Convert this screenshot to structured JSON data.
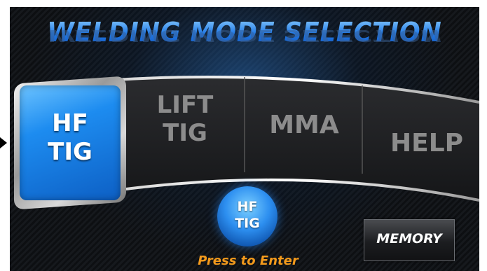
{
  "title": "WELDING MODE SELECTION",
  "tabs": [
    {
      "id": "hf-tig",
      "line1": "HF",
      "line2": "TIG",
      "selected": true
    },
    {
      "id": "lift-tig",
      "line1": "LIFT",
      "line2": "TIG",
      "selected": false
    },
    {
      "id": "mma",
      "line1": "MMA",
      "selected": false
    },
    {
      "id": "help",
      "line1": "HELP",
      "selected": false
    }
  ],
  "current_mode": {
    "line1": "HF",
    "line2": "TIG"
  },
  "press_to_enter": "Press to Enter",
  "memory_button": "MEMORY",
  "colors": {
    "accent_blue": "#1d8cf0",
    "press_orange": "#f39a1c",
    "inactive_text": "#8c8c8c"
  }
}
